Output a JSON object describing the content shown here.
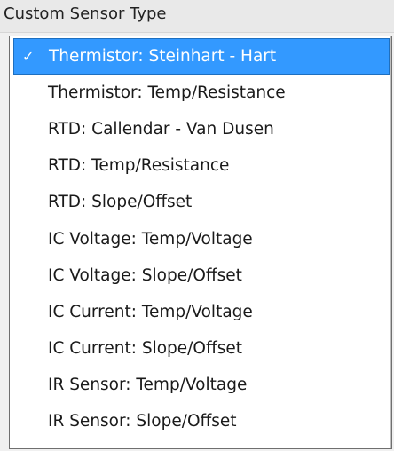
{
  "header": {
    "title": "Custom Sensor Type"
  },
  "dropdown": {
    "selected_index": 0,
    "check_glyph": "✓",
    "items": [
      {
        "label": "Thermistor: Steinhart - Hart"
      },
      {
        "label": "Thermistor: Temp/Resistance"
      },
      {
        "label": "RTD: Callendar - Van Dusen"
      },
      {
        "label": "RTD: Temp/Resistance"
      },
      {
        "label": "RTD: Slope/Offset"
      },
      {
        "label": "IC Voltage: Temp/Voltage"
      },
      {
        "label": "IC Voltage: Slope/Offset"
      },
      {
        "label": "IC Current: Temp/Voltage"
      },
      {
        "label": "IC Current: Slope/Offset"
      },
      {
        "label": "IR Sensor: Temp/Voltage"
      },
      {
        "label": "IR Sensor: Slope/Offset"
      }
    ]
  },
  "colors": {
    "selection_background": "#3399ff",
    "selection_text": "#ffffff",
    "item_text": "#1a1a1a",
    "header_background": "#e9e9e9"
  }
}
